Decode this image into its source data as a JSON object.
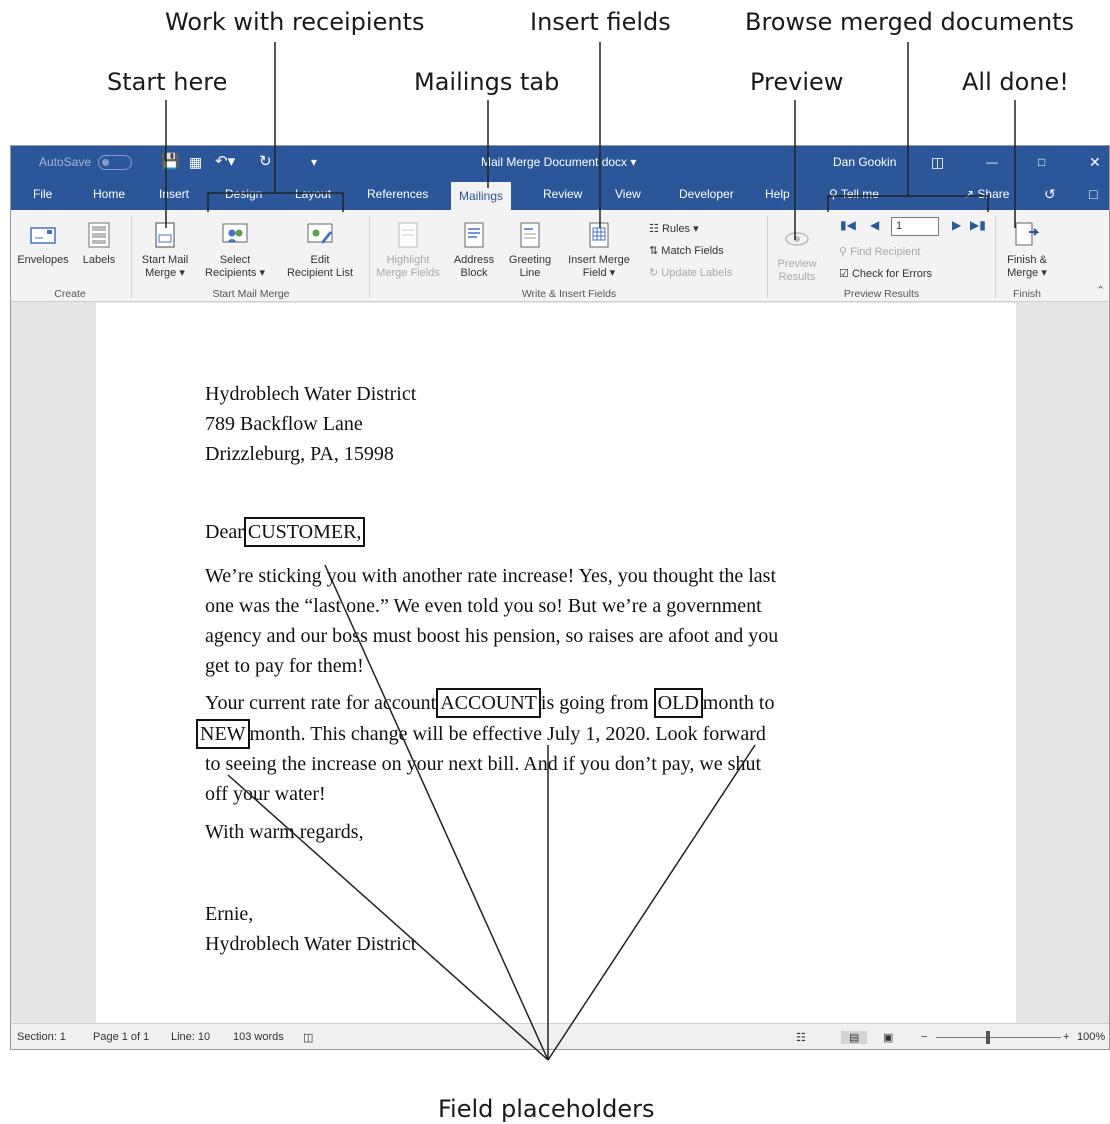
{
  "callouts": {
    "work_with_recipients": "Work with receipients",
    "insert_fields": "Insert fields",
    "browse_merged": "Browse merged documents",
    "start_here": "Start here",
    "mailings_tab": "Mailings tab",
    "preview": "Preview",
    "all_done": "All done!",
    "field_placeholders": "Field placeholders"
  },
  "titlebar": {
    "autosave": "AutoSave",
    "autosave_state": "Off",
    "doc_title": "Mail Merge Document.docx",
    "user": "Dan Gookin"
  },
  "tabs": [
    "File",
    "Home",
    "Insert",
    "Design",
    "Layout",
    "References",
    "Mailings",
    "Review",
    "View",
    "Developer",
    "Help"
  ],
  "tell_me": "Tell me",
  "share": "Share",
  "ribbon": {
    "envelopes": "Envelopes",
    "labels": "Labels",
    "start_mail_merge": [
      "Start Mail",
      "Merge"
    ],
    "select_recipients": [
      "Select",
      "Recipients"
    ],
    "edit_recipient_list": [
      "Edit",
      "Recipient List"
    ],
    "highlight_merge_fields": [
      "Highlight",
      "Merge Fields"
    ],
    "address_block": [
      "Address",
      "Block"
    ],
    "greeting_line": [
      "Greeting",
      "Line"
    ],
    "insert_merge_field": [
      "Insert Merge",
      "Field"
    ],
    "rules": "Rules",
    "match_fields": "Match Fields",
    "update_labels": "Update Labels",
    "preview_results": [
      "Preview",
      "Results"
    ],
    "record_number": "1",
    "find_recipient": "Find Recipient",
    "check_for_errors": "Check for Errors",
    "finish_merge": [
      "Finish &",
      "Merge"
    ],
    "groups": {
      "create": "Create",
      "start_mail_merge": "Start Mail Merge",
      "write_insert": "Write & Insert Fields",
      "preview_results": "Preview Results",
      "finish": "Finish"
    }
  },
  "document": {
    "address": [
      "Hydroblech Water District",
      "789 Backflow Lane",
      "Drizzleburg, PA, 15998"
    ],
    "dear": "Dear",
    "field_customer": "CUSTOMER,",
    "para1": [
      "We’re sticking you with another rate increase! Yes, you thought the last",
      "one was the “last one.” We even told you so! But we’re a government",
      "agency and our boss must boost his pension, so raises are afoot and you",
      "get to pay for them!"
    ],
    "para2_a": "Your current rate for account",
    "field_account": "ACCOUNT",
    "para2_b": "is going from",
    "field_old": "OLD",
    "para2_c": "month to",
    "field_new": "NEW",
    "para2_d": "month. This change will be effective July 1, 2020. Look forward",
    "para2_e": "to seeing the increase on your next bill. And if you don’t pay, we shut",
    "para2_f": "off your water!",
    "closing": "With warm regards,",
    "signature": [
      "Ernie,",
      "Hydroblech Water District"
    ]
  },
  "status": {
    "section": "Section: 1",
    "page": "Page 1 of 1",
    "line": "Line: 10",
    "words": "103 words",
    "zoom": "100%"
  },
  "colors": {
    "word_blue": "#2b579a",
    "ribbon_bg": "#f3f3f3",
    "icon_blue": "#4472c4"
  }
}
